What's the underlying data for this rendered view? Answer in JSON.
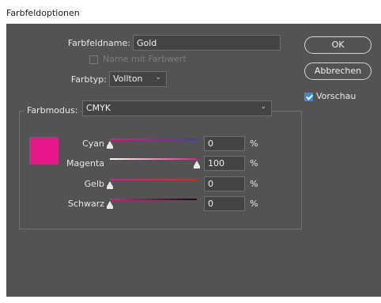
{
  "window": {
    "title": "Farbfeldoptionen"
  },
  "swatch_name": {
    "label": "Farbfeldname:",
    "value": "Gold"
  },
  "name_with_value": {
    "label": "Name mit Farbwert",
    "checked": false
  },
  "color_type": {
    "label": "Farbtyp:",
    "value": "Vollton"
  },
  "color_mode": {
    "label": "Farbmodus:",
    "value": "CMYK"
  },
  "buttons": {
    "ok": "OK",
    "cancel": "Abbrechen"
  },
  "preview": {
    "label": "Vorschau",
    "checked": true
  },
  "swatch_color": "#e6188b",
  "channels": [
    {
      "name": "Cyan",
      "value": "0",
      "unit": "%",
      "fraction": 0.0,
      "gradient": [
        "#e6188b",
        "#4a3aa0"
      ]
    },
    {
      "name": "Magenta",
      "value": "100",
      "unit": "%",
      "fraction": 1.0,
      "gradient": [
        "#ffffff",
        "#e6188b"
      ]
    },
    {
      "name": "Gelb",
      "value": "0",
      "unit": "%",
      "fraction": 0.0,
      "gradient": [
        "#e6188b",
        "#e82020"
      ]
    },
    {
      "name": "Schwarz",
      "value": "0",
      "unit": "%",
      "fraction": 0.0,
      "gradient": [
        "#e6188b",
        "#1a0a12"
      ]
    }
  ]
}
